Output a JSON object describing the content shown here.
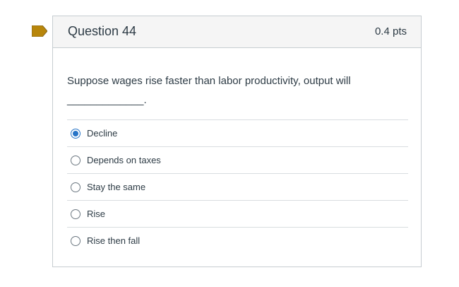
{
  "question": {
    "title": "Question 44",
    "points": "0.4 pts",
    "text": "Suppose wages rise faster than labor productivity, output will",
    "blank": "_____________.",
    "flag_color": "#b8860b",
    "answers": [
      {
        "label": "Decline",
        "selected": true
      },
      {
        "label": "Depends on taxes",
        "selected": false
      },
      {
        "label": "Stay the same",
        "selected": false
      },
      {
        "label": "Rise",
        "selected": false
      },
      {
        "label": "Rise then fall",
        "selected": false
      }
    ]
  },
  "colors": {
    "accent": "#2774c7",
    "header_bg": "#f5f5f5",
    "border": "#c7cdd1"
  }
}
